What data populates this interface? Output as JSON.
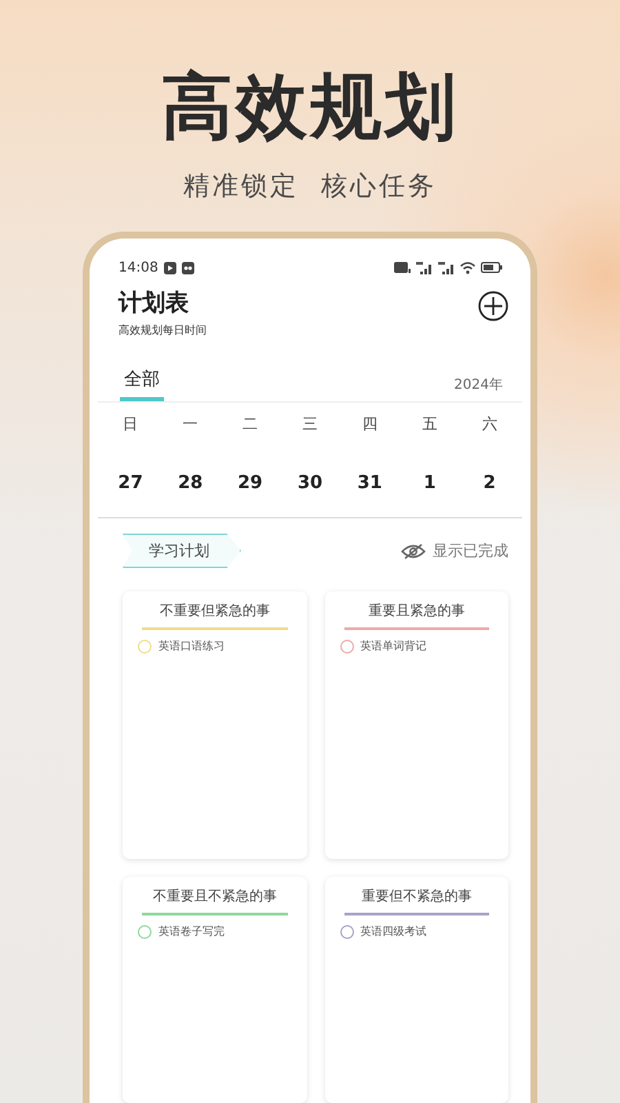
{
  "headline": "高效规划",
  "subheadline": "精准锁定  核心任务",
  "status_bar": {
    "time": "14:08"
  },
  "header": {
    "title": "计划表",
    "subtitle": "高效规划每日时间"
  },
  "tabs": [
    {
      "label": "全部",
      "selected": true
    }
  ],
  "year": "2024年",
  "weekdays": [
    "日",
    "一",
    "二",
    "三",
    "四",
    "五",
    "六"
  ],
  "dates": [
    "27",
    "28",
    "29",
    "30",
    "31",
    "1",
    "2"
  ],
  "category": {
    "label": "学习计划"
  },
  "show_completed": {
    "label": "显示已完成"
  },
  "quadrants": [
    {
      "title": "不重要但紧急的事",
      "color": "#f2dc8a",
      "tasks": [
        {
          "text": "英语口语练习",
          "checked": false
        }
      ]
    },
    {
      "title": "重要且紧急的事",
      "color": "#eeaaa8",
      "tasks": [
        {
          "text": "英语单词背记",
          "checked": false
        }
      ]
    },
    {
      "title": "不重要且不紧急的事",
      "color": "#8fd89a",
      "tasks": [
        {
          "text": "英语卷子写完",
          "checked": false
        }
      ]
    },
    {
      "title": "重要但不紧急的事",
      "color": "#a9a3c8",
      "tasks": [
        {
          "text": "英语四级考试",
          "checked": false
        }
      ]
    }
  ]
}
